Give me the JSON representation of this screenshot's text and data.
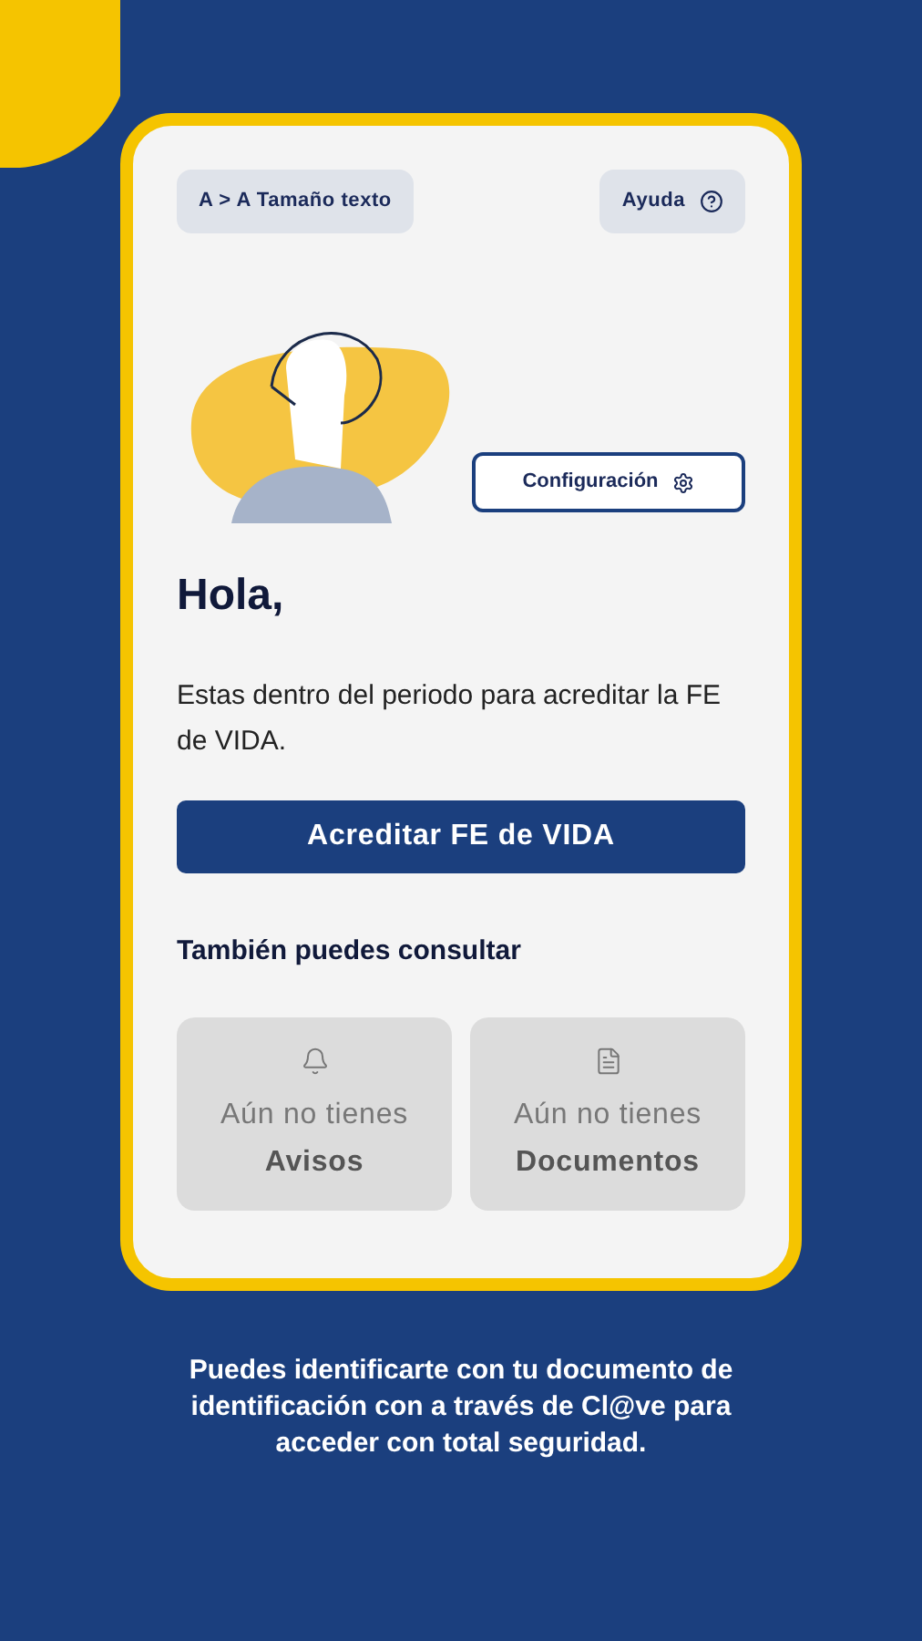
{
  "top_buttons": [
    {
      "kind": "text-size",
      "label": "A > A Tamaño texto"
    },
    {
      "kind": "help",
      "label": "Ayuda"
    }
  ],
  "settings_button": {
    "label": "Configuración"
  },
  "greeting": "Hola,",
  "message": "Estas dentro del periodo para acreditar la FE de VIDA.",
  "primary_button": {
    "label": "Acreditar FE de VIDA"
  },
  "section_title": "También puedes consultar",
  "cards": [
    {
      "kind": "alerts",
      "line1": "Aún no tienes",
      "line2": "Avisos",
      "disabled": true
    },
    {
      "kind": "documents",
      "line1": "Aún no tienes",
      "line2": "Documentos",
      "disabled": true
    }
  ],
  "footer": "Puedes identificarte con tu documento de identificación con a través de Cl@ve para acceder con total seguridad."
}
